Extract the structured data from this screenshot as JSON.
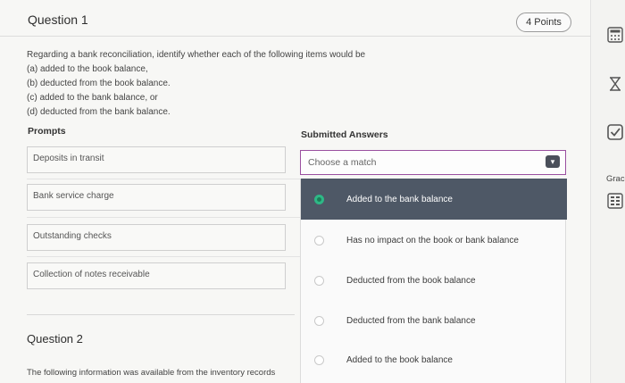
{
  "question1": {
    "title": "Question 1",
    "points": "4 Points",
    "text_lines": [
      "Regarding a bank reconciliation, identify whether each of the following items would be",
      "(a) added to the book balance,",
      "(b) deducted from the book balance.",
      "(c) added to the bank balance, or",
      "(d) deducted from the bank balance."
    ],
    "prompts_label": "Prompts",
    "answers_label": "Submitted Answers",
    "prompts": [
      "Deposits in transit",
      "Bank service charge",
      "Outstanding checks",
      "Collection of notes receivable"
    ],
    "select_placeholder": "Choose a match",
    "options": [
      {
        "label": "Added to the bank balance",
        "selected": true
      },
      {
        "label": "Has no impact on the book or bank balance",
        "selected": false
      },
      {
        "label": "Deducted from the book balance",
        "selected": false
      },
      {
        "label": "Deducted from the bank balance",
        "selected": false
      },
      {
        "label": "Added to the book balance",
        "selected": false
      }
    ]
  },
  "question2": {
    "title": "Question 2",
    "text": "The following information was available from the inventory records"
  },
  "sidebar": {
    "grade_label": "Grac",
    "icons": [
      "calculator-icon",
      "hourglass-icon",
      "checkbox-icon",
      "gradebook-icon"
    ]
  },
  "colors": {
    "selected_option_bg": "#4e5866",
    "radio_selected": "#2eb886",
    "select_border": "#9a4fa0"
  }
}
